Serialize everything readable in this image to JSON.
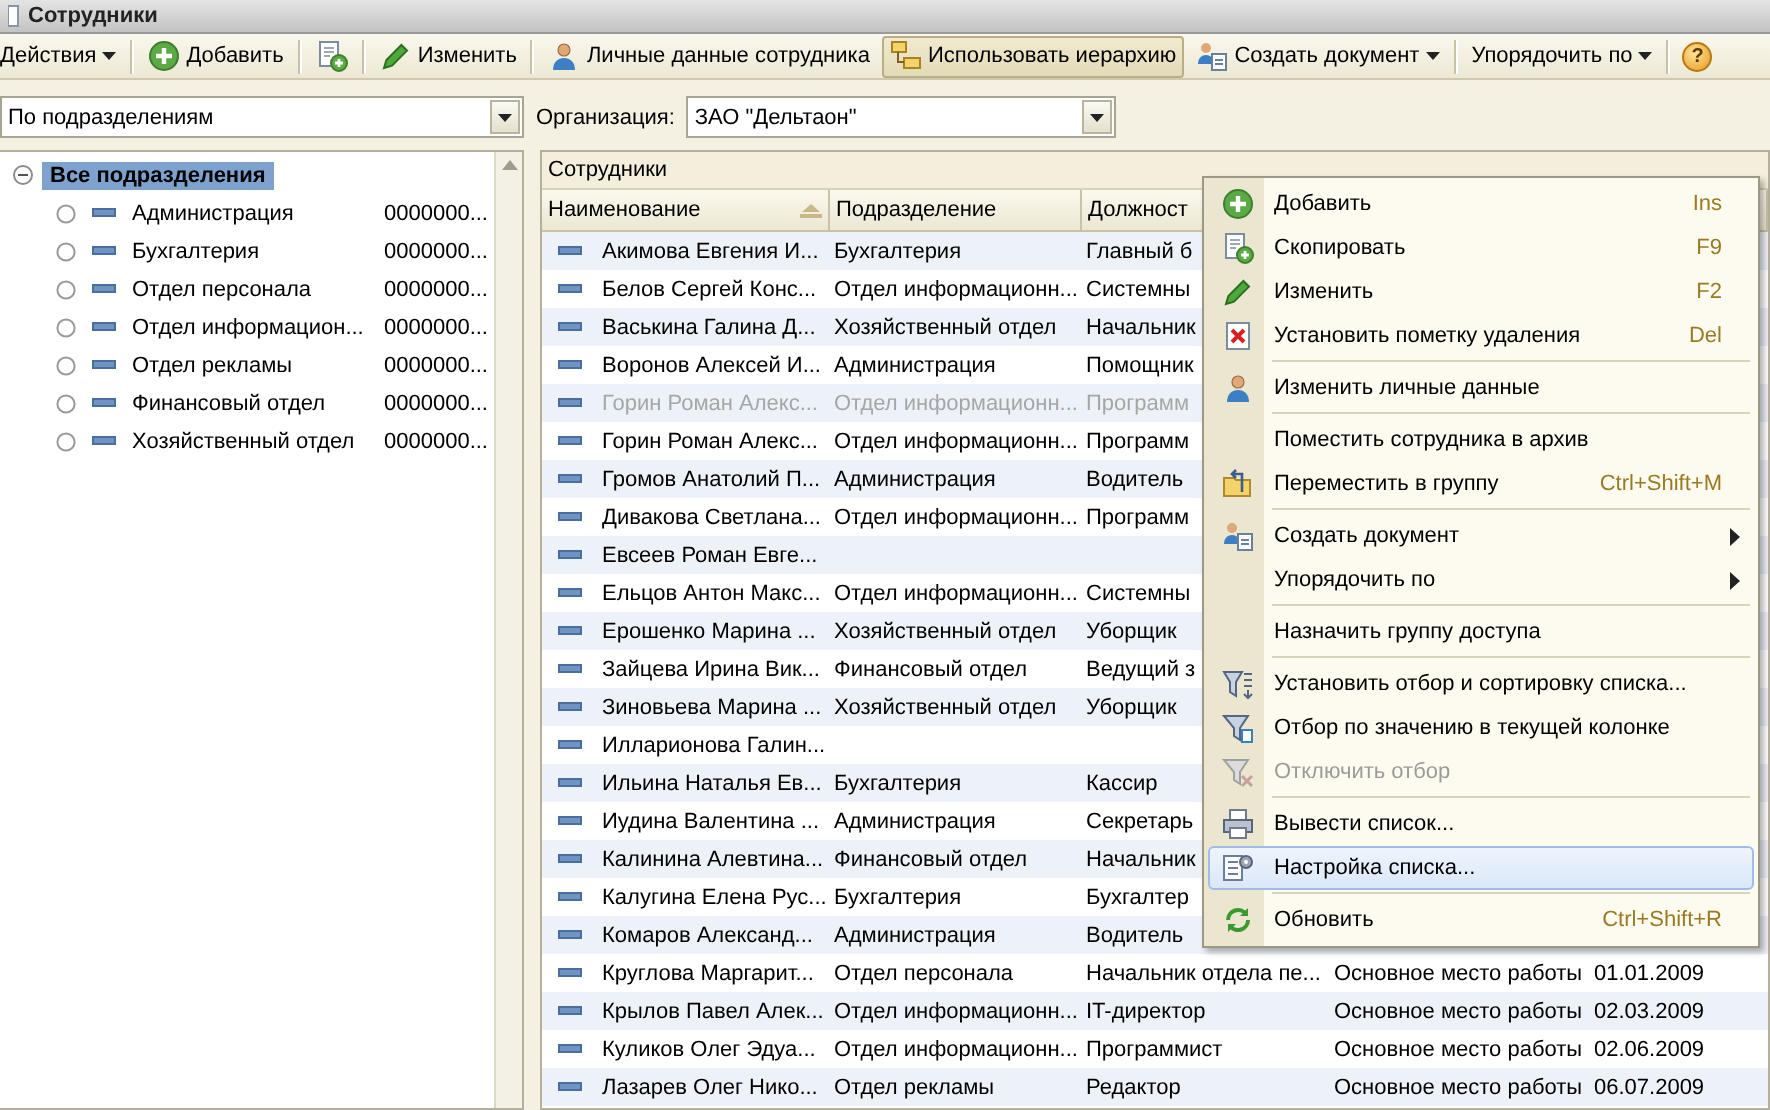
{
  "window": {
    "title": "Сотрудники"
  },
  "toolbar": [
    {
      "kind": "menu",
      "label": "Действия",
      "pressed": false
    },
    {
      "kind": "separator"
    },
    {
      "kind": "button",
      "label": "Добавить",
      "pressed": false
    },
    {
      "kind": "separator"
    },
    {
      "kind": "button",
      "pressed": false
    },
    {
      "kind": "separator"
    },
    {
      "kind": "button",
      "label": "Изменить",
      "pressed": false
    },
    {
      "kind": "separator"
    },
    {
      "kind": "button",
      "label": "Личные данные сотрудника",
      "pressed": false
    },
    {
      "kind": "button",
      "label": "Использовать иерархию",
      "pressed": true
    },
    {
      "kind": "menu",
      "label": "Создать документ",
      "pressed": false
    },
    {
      "kind": "separator"
    },
    {
      "kind": "menu",
      "label": "Упорядочить по",
      "pressed": false
    },
    {
      "kind": "separator"
    },
    {
      "kind": "help",
      "label": "?"
    }
  ],
  "filters": {
    "grouping": {
      "value": "По подразделениям"
    },
    "organization": {
      "label": "Организация:",
      "value": "ЗАО \"Дельтаон\""
    }
  },
  "tree": {
    "label": "Все подразделения",
    "expanded": true,
    "selected": true,
    "children": [
      {
        "label": "Администрация",
        "code": "0000000...",
        "selected": false
      },
      {
        "label": "Бухгалтерия",
        "code": "0000000...",
        "selected": false
      },
      {
        "label": "Отдел персонала",
        "code": "0000000...",
        "selected": false
      },
      {
        "label": "Отдел информацион...",
        "code": "0000000...",
        "selected": false
      },
      {
        "label": "Отдел рекламы",
        "code": "0000000...",
        "selected": false
      },
      {
        "label": "Финансовый отдел",
        "code": "0000000...",
        "selected": false
      },
      {
        "label": "Хозяйственный отдел",
        "code": "0000000...",
        "selected": false
      }
    ]
  },
  "table": {
    "title": "Сотрудники",
    "columns": [
      {
        "label": "Наименование",
        "sorted": true
      },
      {
        "label": "Подразделение",
        "sorted": false
      },
      {
        "label": "Должност"
      }
    ],
    "rows": [
      {
        "name": "Акимова Евгения И...",
        "department": "Бухгалтерия",
        "position": "Главный б",
        "dimmed": false
      },
      {
        "name": "Белов Сергей Конс...",
        "department": "Отдел информационн...",
        "position": "Системны",
        "dimmed": false
      },
      {
        "name": "Васькина Галина Д...",
        "department": "Хозяйственный отдел",
        "position": "Начальник",
        "dimmed": false
      },
      {
        "name": "Воронов Алексей И...",
        "department": "Администрация",
        "position": "Помощник",
        "dimmed": false
      },
      {
        "name": "Горин Роман Алекс...",
        "department": "Отдел информационн...",
        "position": "Программ",
        "dimmed": true
      },
      {
        "name": "Горин Роман Алекс...",
        "department": "Отдел информационн...",
        "position": "Программ",
        "dimmed": false
      },
      {
        "name": "Громов Анатолий П...",
        "department": "Администрация",
        "position": "Водитель",
        "dimmed": false
      },
      {
        "name": "Дивакова Светлана...",
        "department": "Отдел информационн...",
        "position": "Программ",
        "dimmed": false
      },
      {
        "name": "Евсеев Роман Евге...",
        "dimmed": false
      },
      {
        "name": "Ельцов Антон Макс...",
        "department": "Отдел информационн...",
        "position": "Системны",
        "dimmed": false
      },
      {
        "name": "Ерошенко Марина ...",
        "department": "Хозяйственный отдел",
        "position": "Уборщик",
        "dimmed": false
      },
      {
        "name": "Зайцева Ирина Вик...",
        "department": "Финансовый отдел",
        "position": "Ведущий з",
        "dimmed": false
      },
      {
        "name": "Зиновьева Марина ...",
        "department": "Хозяйственный отдел",
        "position": "Уборщик",
        "dimmed": false
      },
      {
        "name": "Илларионова Галин...",
        "dimmed": false
      },
      {
        "name": "Ильина Наталья Ев...",
        "department": "Бухгалтерия",
        "position": "Кассир",
        "dimmed": false
      },
      {
        "name": "Иудина Валентина ...",
        "department": "Администрация",
        "position": "Секретарь",
        "dimmed": false
      },
      {
        "name": "Калинина Алевтина...",
        "department": "Финансовый отдел",
        "position": "Начальник",
        "dimmed": false
      },
      {
        "name": "Калугина Елена Рус...",
        "department": "Бухгалтерия",
        "position": "Бухгалтер",
        "dimmed": false
      },
      {
        "name": "Комаров Александ...",
        "department": "Администрация",
        "position": "Водитель",
        "dimmed": false
      },
      {
        "name": "Круглова Маргарит...",
        "department": "Отдел персонала",
        "position": "Начальник отдела пе...",
        "column_4": "Основное место работы",
        "column_5": "01.01.2009",
        "dimmed": false
      },
      {
        "name": "Крылов Павел Алек...",
        "department": "Отдел информационн...",
        "position": "IT-директор",
        "column_4": "Основное место работы",
        "column_5": "02.03.2009",
        "dimmed": false
      },
      {
        "name": "Куликов Олег Эдуа...",
        "department": "Отдел информационн...",
        "position": "Программист",
        "column_4": "Основное место работы",
        "column_5": "02.06.2009",
        "dimmed": false
      },
      {
        "name": "Лазарев Олег Нико...",
        "department": "Отдел рекламы",
        "position": "Редактор",
        "column_4": "Основное место работы",
        "column_5": "06.07.2009",
        "dimmed": false
      }
    ]
  },
  "context_menu": {
    "items": [
      {
        "kind": "item",
        "label": "Добавить",
        "shortcut": "Ins",
        "selected": false,
        "disabled": false,
        "submenu": false
      },
      {
        "kind": "item",
        "label": "Скопировать",
        "shortcut": "F9",
        "selected": false,
        "disabled": false,
        "submenu": false
      },
      {
        "kind": "item",
        "label": "Изменить",
        "shortcut": "F2",
        "selected": false,
        "disabled": false,
        "submenu": false
      },
      {
        "kind": "item",
        "label": "Установить пометку удаления",
        "shortcut": "Del",
        "selected": false,
        "disabled": false,
        "submenu": false
      },
      {
        "kind": "separator"
      },
      {
        "kind": "item",
        "label": "Изменить личные данные",
        "selected": false,
        "disabled": false,
        "submenu": false
      },
      {
        "kind": "separator"
      },
      {
        "kind": "item",
        "label": "Поместить сотрудника в архив",
        "selected": false,
        "disabled": false,
        "submenu": false
      },
      {
        "kind": "item",
        "label": "Переместить в группу",
        "shortcut": "Ctrl+Shift+M",
        "selected": false,
        "disabled": false,
        "submenu": false
      },
      {
        "kind": "separator"
      },
      {
        "kind": "item",
        "label": "Создать документ",
        "selected": false,
        "disabled": false,
        "submenu": true
      },
      {
        "kind": "item",
        "label": "Упорядочить по",
        "selected": false,
        "disabled": false,
        "submenu": true
      },
      {
        "kind": "separator"
      },
      {
        "kind": "item",
        "label": "Назначить группу доступа",
        "selected": false,
        "disabled": false,
        "submenu": false
      },
      {
        "kind": "separator"
      },
      {
        "kind": "item",
        "label": "Установить отбор и сортировку списка...",
        "selected": false,
        "disabled": false,
        "submenu": false
      },
      {
        "kind": "item",
        "label": "Отбор по значению в текущей колонке",
        "selected": false,
        "disabled": false,
        "submenu": false
      },
      {
        "kind": "item",
        "label": "Отключить отбор",
        "selected": false,
        "disabled": true,
        "submenu": false
      },
      {
        "kind": "separator"
      },
      {
        "kind": "item",
        "label": "Вывести список...",
        "selected": false,
        "disabled": false,
        "submenu": false
      },
      {
        "kind": "item",
        "label": "Настройка списка...",
        "selected": true,
        "disabled": false,
        "submenu": false
      },
      {
        "kind": "separator"
      },
      {
        "kind": "item",
        "label": "Обновить",
        "shortcut": "Ctrl+Shift+R",
        "selected": false,
        "disabled": false,
        "submenu": false
      }
    ]
  }
}
